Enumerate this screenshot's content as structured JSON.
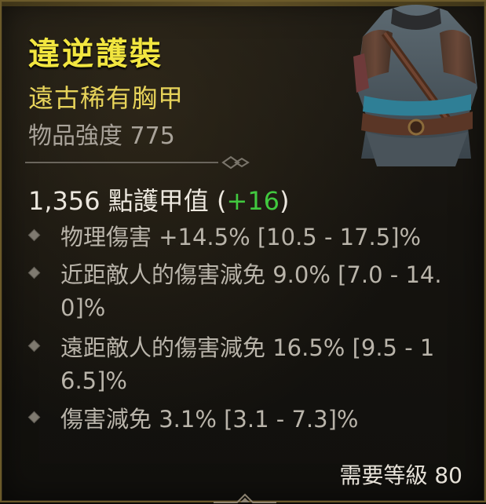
{
  "item": {
    "name": "違逆護裝",
    "type": "遠古稀有胸甲",
    "power": "物品強度 775",
    "armor": {
      "text": "1,356 點護甲值",
      "paren_open": "(",
      "bonus": "+16",
      "paren_close": ")"
    },
    "affixes": [
      "物理傷害 +14.5% [10.5 - 17.5]%",
      "近距敵人的傷害減免 9.0% [7.0 - 14.0]%",
      "遠距敵人的傷害減免 16.5% [9.5 - 16.5]%",
      "傷害減免 3.1% [3.1 - 7.3]%"
    ],
    "requirement": "需要等級 80"
  },
  "colors": {
    "name": "#f2e640",
    "type": "#e7d35a",
    "bonus": "#41c93f",
    "affix": "#b9b4aa",
    "border": "#6b5a2a"
  },
  "icons": {
    "armor": "chest-armor-icon",
    "bullet": "diamond-bullet-icon"
  }
}
